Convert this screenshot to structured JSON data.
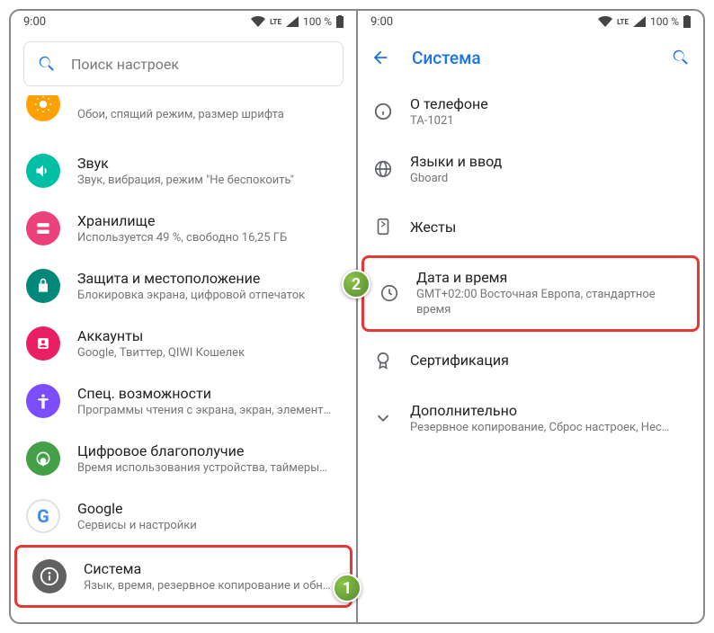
{
  "status": {
    "time": "9:00",
    "net": "LTE",
    "battery": "100 %"
  },
  "left": {
    "search_placeholder": "Поиск настроек",
    "items": [
      {
        "title": "",
        "sub": "Обои, спящий режим, размер шрифта"
      },
      {
        "title": "Звук",
        "sub": "Звук, вибрация, режим \"Не беспокоить\""
      },
      {
        "title": "Хранилище",
        "sub": "Используется 49 %, свободно 16,25 ГБ"
      },
      {
        "title": "Защита и местоположение",
        "sub": "Блокировка экрана, цифровой отпечаток"
      },
      {
        "title": "Аккаунты",
        "sub": "Google, Твиттер, QIWI Кошелек"
      },
      {
        "title": "Спец. возможности",
        "sub": "Программы чтения с экрана, экран, элемент…"
      },
      {
        "title": "Цифровое благополучие",
        "sub": "Время использования устройства, таймеры…"
      },
      {
        "title": "Google",
        "sub": "Сервисы и настройки"
      },
      {
        "title": "Система",
        "sub": "Язык, время, резервное копирование и обно…"
      }
    ]
  },
  "right": {
    "title": "Система",
    "items": [
      {
        "title": "О телефоне",
        "sub": "TA-1021"
      },
      {
        "title": "Языки и ввод",
        "sub": "Gboard"
      },
      {
        "title": "Жесты",
        "sub": ""
      },
      {
        "title": "Дата и время",
        "sub": "GMT+02:00 Восточная Европа, стандартное время"
      },
      {
        "title": "Сертификация",
        "sub": ""
      },
      {
        "title": "Дополнительно",
        "sub": "Резервное копирование, Сброс настроек, Нес…"
      }
    ]
  },
  "badges": {
    "one": "1",
    "two": "2"
  }
}
